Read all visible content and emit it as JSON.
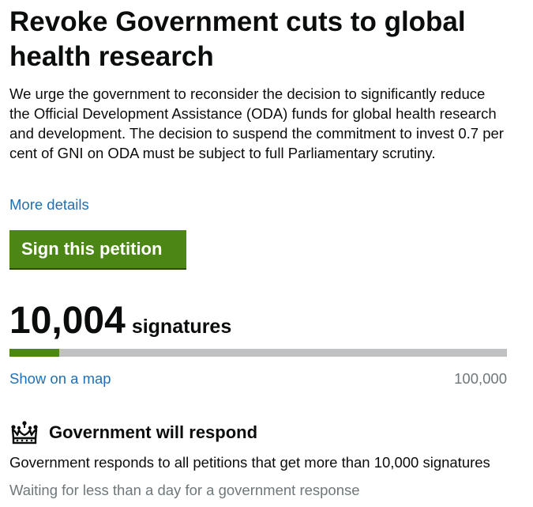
{
  "petition": {
    "title": "Revoke Government cuts to global health research",
    "summary": "We urge the government to reconsider the decision to significantly reduce the Official Development Assistance (ODA) funds for global health research and development. The decision to suspend the commitment to invest 0.7 per cent of GNI on ODA must be subject to full Parliamentary scrutiny.",
    "more_details_label": "More details",
    "sign_button_label": "Sign this petition"
  },
  "signatures": {
    "count": "10,004",
    "label": "signatures",
    "target": "100,000",
    "progress_fraction": 0.10004,
    "show_map_label": "Show on a map"
  },
  "response": {
    "icon": "crown-icon",
    "title": "Government will respond",
    "description": "Government responds to all petitions that get more than 10,000 signatures",
    "status": "Waiting for less than a day for a government response"
  },
  "colors": {
    "accent_green": "#4c8615",
    "link_blue": "#1d70b8",
    "secondary_text": "#6f777b",
    "progress_track": "#bfc1c3"
  }
}
